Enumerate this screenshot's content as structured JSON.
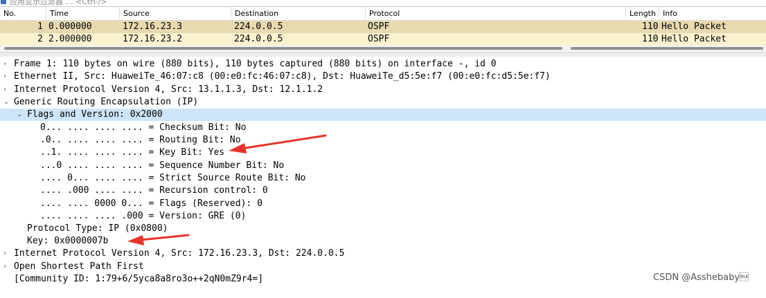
{
  "filter_bar": {
    "placeholder": "应用显示过滤器 … <Ctrl-/>",
    "icon": "bookmark-icon"
  },
  "packet_list": {
    "columns": [
      "No.",
      "Time",
      "Source",
      "Destination",
      "Protocol",
      "Length",
      "Info"
    ],
    "rows": [
      {
        "no": "1",
        "time": "0.000000",
        "source": "172.16.23.3",
        "destination": "224.0.0.5",
        "protocol": "OSPF",
        "length": "110",
        "info": "Hello Packet"
      },
      {
        "no": "2",
        "time": "2.000000",
        "source": "172.16.23.2",
        "destination": "224.0.0.5",
        "protocol": "OSPF",
        "length": "110",
        "info": "Hello Packet"
      }
    ]
  },
  "details": {
    "frame": "Frame 1: 110 bytes on wire (880 bits), 110 bytes captured (880 bits) on interface -, id 0",
    "ethernet": "Ethernet II, Src: HuaweiTe_46:07:c8 (00:e0:fc:46:07:c8), Dst: HuaweiTe_d5:5e:f7 (00:e0:fc:d5:5e:f7)",
    "ipv4_outer": "Internet Protocol Version 4, Src: 13.1.1.3, Dst: 12.1.1.2",
    "gre": "Generic Routing Encapsulation (IP)",
    "flags_version": "Flags and Version: 0x2000",
    "flag_bits": [
      "0... .... .... .... = Checksum Bit: No",
      ".0.. .... .... .... = Routing Bit: No",
      "..1. .... .... .... = Key Bit: Yes",
      "...0 .... .... .... = Sequence Number Bit: No",
      ".... 0... .... .... = Strict Source Route Bit: No",
      ".... .000 .... .... = Recursion control: 0",
      ".... .... 0000 0... = Flags (Reserved): 0",
      ".... .... .... .000 = Version: GRE (0)"
    ],
    "protocol_type": "Protocol Type: IP (0x0800)",
    "key": "Key: 0x0000007b",
    "ipv4_inner": "Internet Protocol Version 4, Src: 172.16.23.3, Dst: 224.0.0.5",
    "ospf": "Open Shortest Path First",
    "community_id": "[Community ID: 1:79+6/5yca8a8ro3o++2qN0mZ9r4=]"
  },
  "watermark": "CSDN @Asshebaby\u0010",
  "colors": {
    "row_selected": "#e7d9b0",
    "row_normal": "#fbf2cf",
    "detail_selected": "#cde5f8",
    "annotation_arrow": "#e8332a"
  }
}
